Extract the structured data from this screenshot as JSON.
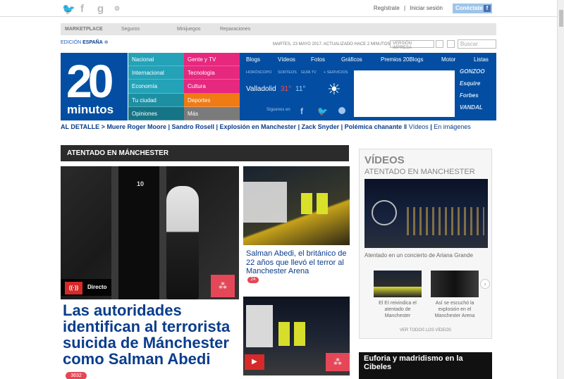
{
  "topbar": {
    "social": [
      {
        "name": "twitter-icon",
        "glyph": "🐦"
      },
      {
        "name": "facebook-icon",
        "glyph": "f"
      },
      {
        "name": "google-plus-icon",
        "glyph": "g"
      },
      {
        "name": "settings-icon",
        "glyph": "⚙"
      }
    ],
    "register": "Regístrate",
    "separator": "|",
    "login": "Iniciar sesión",
    "connect": "Conéctate",
    "fb_glyph": "f"
  },
  "marketplace": {
    "label": "MARKETPLACE",
    "items": [
      "Seguros",
      "Minijuegos",
      "Reparaciones"
    ]
  },
  "edition": {
    "prefix": "EDICIÓN",
    "country": "ESPAÑA",
    "plus": "⊕"
  },
  "dateline": "MARTES, 23 MAYO 2017. ACTUALIZADO HACE 2 MINUTOS",
  "print_version": "VERSIÓN IMPRESA",
  "search_placeholder": "Buscar",
  "logo": {
    "number": "20",
    "word": "minutos"
  },
  "nav": {
    "col1": [
      "Nacional",
      "Internacional",
      "Economía",
      "Tu ciudad",
      "Opiniones"
    ],
    "col2": [
      "Gente y TV",
      "Tecnología",
      "Cultura",
      "Deportes",
      "Más"
    ],
    "col1_colors": [
      "#24a2b8",
      "#24a2b8",
      "#24a2b8",
      "#1d8fa3",
      "#157586"
    ],
    "col2_colors": [
      "#e6287f",
      "#e6287f",
      "#e6287f",
      "#f07a14",
      "#7b7b7b"
    ]
  },
  "tabs": [
    "Blogs",
    "Vídeos",
    "Fotos",
    "Gráficos",
    "Premios 20Blogs",
    "Motor",
    "Listas"
  ],
  "subnav": [
    "HORÓSCOPO",
    "SORTEOS",
    "GUÍA TV",
    "+ SERVICIOS"
  ],
  "weather": {
    "city": "Valladolid",
    "max": "31°",
    "min": "11°",
    "icon": "sun-icon",
    "glyph": "☀"
  },
  "follow": "Síguenos en",
  "partners": [
    "GONZOO",
    "Esquire",
    "Forbes",
    "VANDAL"
  ],
  "hotlinks": {
    "lead": "AL DETALLE >",
    "items": [
      "Muere Roger Moore",
      "Sandro Rosell",
      "Explosión en Manchester",
      "Zack Snyder",
      "Polémica chanante"
    ],
    "extra": [
      "Vídeos",
      "En imágenes"
    ]
  },
  "section": {
    "title": "ATENTADO EN MÁNCHESTER"
  },
  "main_story": {
    "door_number": "10",
    "live_label": "Directo",
    "headline": "Las autoridades identifican al terrorista suicida de Mánchester como Salman Abedi",
    "comments": "3632"
  },
  "story2": {
    "caption": "Salman Abedi, el británico de 22 años que llevó el terror al Manchester Arena",
    "comments": "24"
  },
  "videos": {
    "title": "VÍDEOS",
    "subtitle": "ATENTADO EN MANCHESTER",
    "main_caption": "Atentado en un concierto de Ariana Grande",
    "items": [
      {
        "caption": "El EI reivindica el atentado de Manchester"
      },
      {
        "caption": "Así se escuchó la explosión en el Manchester Arena"
      }
    ],
    "see_all": "VER TODOS LOS VÍDEOS",
    "next": "›"
  },
  "promo": {
    "title": "Euforia y madridismo en la Cibeles"
  }
}
